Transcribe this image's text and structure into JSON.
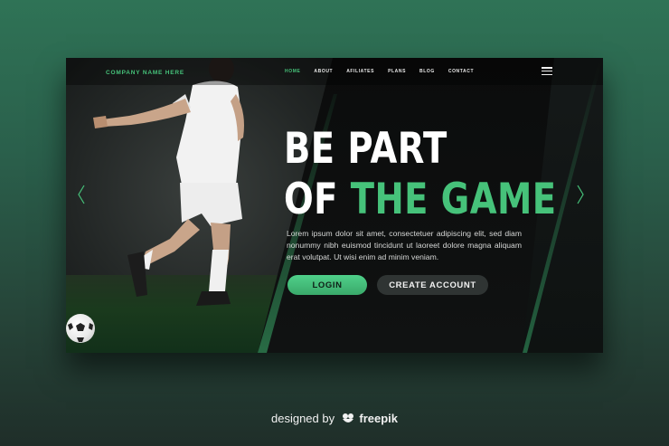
{
  "brand": {
    "name": "COMPANY NAME HERE"
  },
  "nav": {
    "items": [
      {
        "label": "HOME",
        "active": true
      },
      {
        "label": "ABOUT",
        "active": false
      },
      {
        "label": "AFILIATES",
        "active": false
      },
      {
        "label": "PLANS",
        "active": false
      },
      {
        "label": "BLOG",
        "active": false
      },
      {
        "label": "CONTACT",
        "active": false
      }
    ],
    "menu_icon": "hamburger-menu-icon"
  },
  "hero": {
    "line1": "BE PART",
    "line2_white": "OF ",
    "line2_green": "THE GAME",
    "body": "Lorem ipsum dolor sit amet, consectetuer adipiscing elit, sed diam nonummy nibh euismod tincidunt ut laoreet dolore magna aliquam erat volutpat. Ut wisi enim ad minim veniam.",
    "login_label": "LOGIN",
    "create_label": "CREATE ACCOUNT"
  },
  "carousel": {
    "prev_icon": "chevron-left-icon",
    "next_icon": "chevron-right-icon"
  },
  "credit": {
    "prefix": "designed by",
    "brand": "freepik"
  },
  "colors": {
    "accent": "#46c27a",
    "card_bg": "#121414",
    "page_bg": "#2a5f4b"
  }
}
